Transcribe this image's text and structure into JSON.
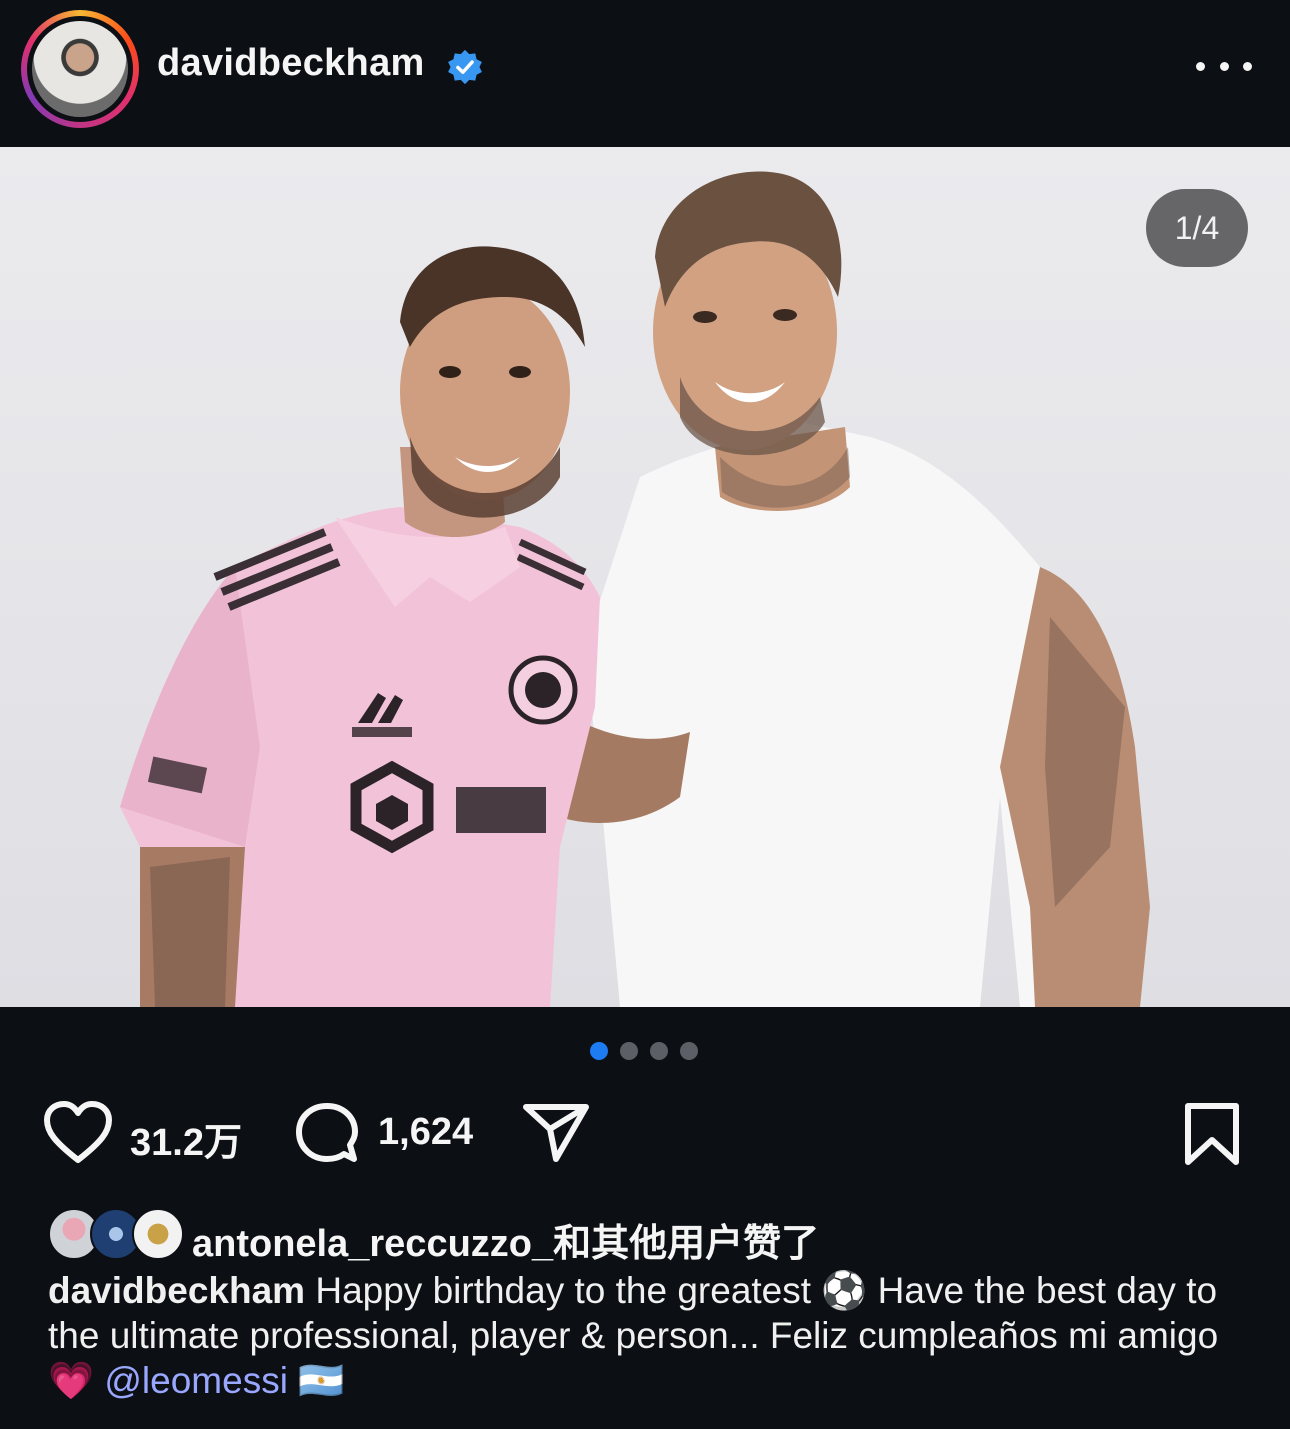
{
  "header": {
    "username": "davidbeckham",
    "verified_icon": "verified-badge-icon",
    "more_icon": "more-horizontal-icon"
  },
  "post": {
    "image_counter": "1/4",
    "carousel": {
      "total": 4,
      "active_index": 0
    }
  },
  "actions": {
    "like_count": "31.2万",
    "comment_count": "1,624"
  },
  "likes": {
    "text": "antonela_reccuzzo_和其他用户赞了"
  },
  "caption": {
    "user": "davidbeckham",
    "text_1": "Happy birthday to the greatest ",
    "emoji_ball": "⚽",
    "text_2": " Have the best day to the ultimate professional, player & person... Feliz cumpleaños mi amigo ",
    "emoji_heart": "💗",
    "mention": "@leomessi",
    "emoji_flag": "🇦🇷"
  },
  "colors": {
    "background": "#0c0f14",
    "accent_blue": "#1d7cf2",
    "mention": "#9aa7ff",
    "jersey_pink": "#f2c3d8"
  }
}
